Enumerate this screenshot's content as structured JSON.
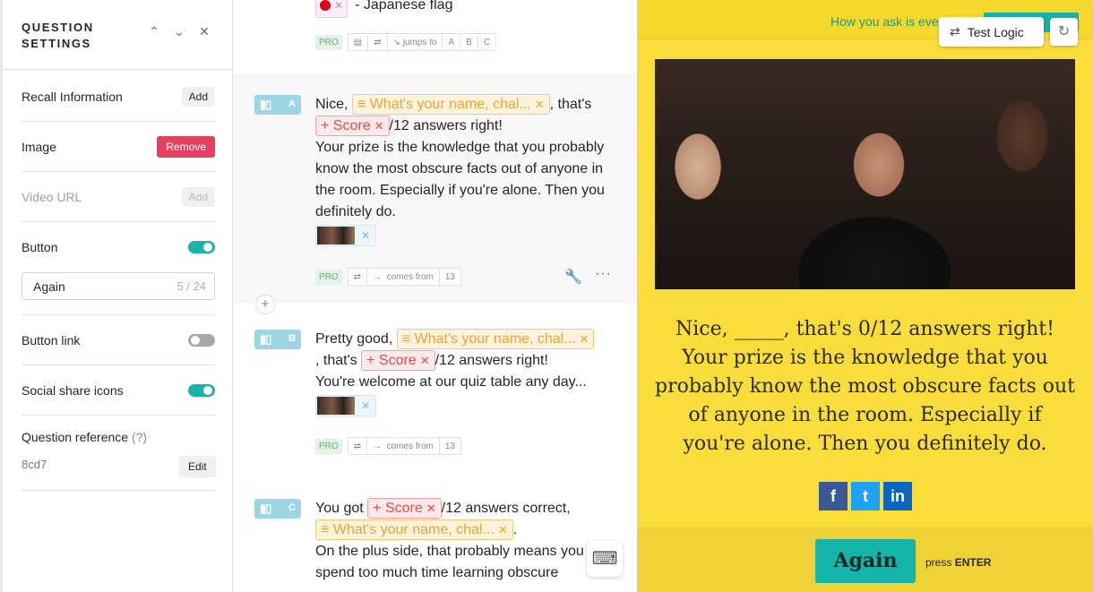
{
  "panel": {
    "title": "QUESTION SETTINGS",
    "recall_label": "Recall Information",
    "recall_btn": "Add",
    "image_label": "Image",
    "image_btn": "Remove",
    "video_label": "Video URL",
    "video_btn": "Add",
    "button_label": "Button",
    "button_on": true,
    "button_value": "Again",
    "button_count": "5 / 24",
    "buttonlink_label": "Button link",
    "buttonlink_on": false,
    "social_label": "Social share icons",
    "social_on": true,
    "ref_label": "Question reference",
    "ref_help": "(?)",
    "ref_value": "8cd7",
    "ref_btn": "Edit"
  },
  "editor": {
    "top": {
      "fragment": "- Japanese flag",
      "pro": "PRO",
      "jumps_label": "jumps to",
      "jumps": [
        "A",
        "B",
        "C"
      ]
    },
    "blocks": [
      {
        "letter": "A",
        "line1_start": "Nice,",
        "name_pill": "What's your name, chal...",
        "line1_end": ", that's",
        "score_pill": "Score",
        "score_end": "/12 answers right!",
        "body": "Your prize is the knowledge that you probably know the most obscure facts out of anyone in the room. Especially if you're alone. Then you definitely do.",
        "pro": "PRO",
        "comes_label": "comes from",
        "comes_num": "13"
      },
      {
        "letter": "B",
        "line1_start": "Pretty good,",
        "name_pill": "What's your name, chal...",
        "line2_start": ", that's",
        "score_pill": "Score",
        "score_end": "/12 answers right!",
        "body": "You're welcome at our quiz table any day...",
        "pro": "PRO",
        "comes_label": "comes from",
        "comes_num": "13"
      },
      {
        "letter": "C",
        "line1_start": "You got",
        "score_pill": "Score",
        "score_end": "/12 answers correct,",
        "name_pill": "What's your name, chal...",
        "name_end": ".",
        "body": "On the plus side, that probably means you don't spend too much time learning obscure"
      }
    ]
  },
  "preview": {
    "top_msg": "How you ask is eve",
    "test_logic": "Test Logic",
    "body": "Nice, _____, that's 0/12 answers right! Your prize is the knowledge that you probably know the most obscure facts out of anyone in the room. Especially if you're alone. Then you definitely do.",
    "social": [
      "f",
      "t",
      "in"
    ],
    "button": "Again",
    "press": "press",
    "enter": "ENTER"
  },
  "colors": {
    "accent": "#14b4aa",
    "preview_bg": "#f8dd3b",
    "remove": "#e4405f"
  }
}
